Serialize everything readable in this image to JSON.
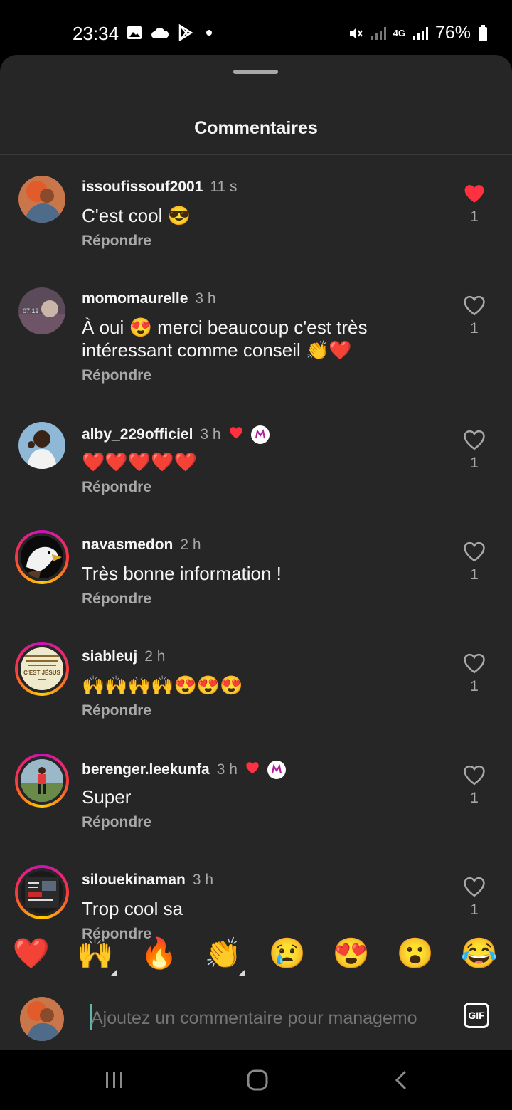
{
  "status_bar": {
    "time": "23:34",
    "battery": "76%",
    "network": "4G",
    "icons_left": [
      "image-icon",
      "cloud-icon",
      "play-store-icon",
      "dot-icon"
    ],
    "icons_right": [
      "mute-icon",
      "signal-icon",
      "4g-icon",
      "signal-icon",
      "battery-icon"
    ]
  },
  "sheet": {
    "title": "Commentaires"
  },
  "comments": [
    {
      "username": "issoufissouf2001",
      "time": "11 s",
      "text": "C'est cool 😎",
      "reply": "Répondre",
      "likes": "1",
      "liked": true,
      "creator_heart": false,
      "avatar_ring": false
    },
    {
      "username": "momomaurelle",
      "time": "3 h",
      "text": "À oui 😍 merci beaucoup c'est très intéressant comme conseil 👏❤️",
      "reply": "Répondre",
      "likes": "1",
      "liked": false,
      "creator_heart": false,
      "avatar_ring": false,
      "avatar_text": "07.12"
    },
    {
      "username": "alby_229officiel",
      "time": "3 h",
      "text": "❤️❤️❤️❤️❤️",
      "reply": "Répondre",
      "likes": "1",
      "liked": false,
      "creator_heart": true,
      "avatar_ring": false
    },
    {
      "username": "navasmedon",
      "time": "2 h",
      "text": "Très bonne information !",
      "reply": "Répondre",
      "likes": "1",
      "liked": false,
      "creator_heart": false,
      "avatar_ring": true
    },
    {
      "username": "siableuj",
      "time": "2 h",
      "text": "🙌🙌🙌🙌😍😍😍",
      "reply": "Répondre",
      "likes": "1",
      "liked": false,
      "creator_heart": false,
      "avatar_ring": true,
      "avatar_text": "C'EST JÉSUS"
    },
    {
      "username": "berenger.leekunfa",
      "time": "3 h",
      "text": "Super",
      "reply": "Répondre",
      "likes": "1",
      "liked": false,
      "creator_heart": true,
      "avatar_ring": true
    },
    {
      "username": "silouekinaman",
      "time": "3 h",
      "text": "Trop cool sa",
      "reply": "Répondre",
      "likes": "1",
      "liked": false,
      "creator_heart": false,
      "avatar_ring": true
    }
  ],
  "emoji_bar": [
    {
      "emoji": "❤️",
      "name": "heart-emoji-button",
      "has_variants": false
    },
    {
      "emoji": "🙌",
      "name": "raising-hands-emoji-button",
      "has_variants": true
    },
    {
      "emoji": "🔥",
      "name": "fire-emoji-button",
      "has_variants": false
    },
    {
      "emoji": "👏",
      "name": "clapping-emoji-button",
      "has_variants": true
    },
    {
      "emoji": "😢",
      "name": "crying-emoji-button",
      "has_variants": false
    },
    {
      "emoji": "😍",
      "name": "heart-eyes-emoji-button",
      "has_variants": false
    },
    {
      "emoji": "😮",
      "name": "surprised-emoji-button",
      "has_variants": false
    },
    {
      "emoji": "😂",
      "name": "laughing-emoji-button",
      "has_variants": false
    }
  ],
  "input": {
    "placeholder": "Ajoutez un commentaire pour managemo",
    "gif_label": "GIF"
  },
  "colors": {
    "sheet_bg": "#262626",
    "like_red": "#ff3040",
    "secondary_text": "#a8a8a8",
    "caret": "#5fb8ad"
  }
}
